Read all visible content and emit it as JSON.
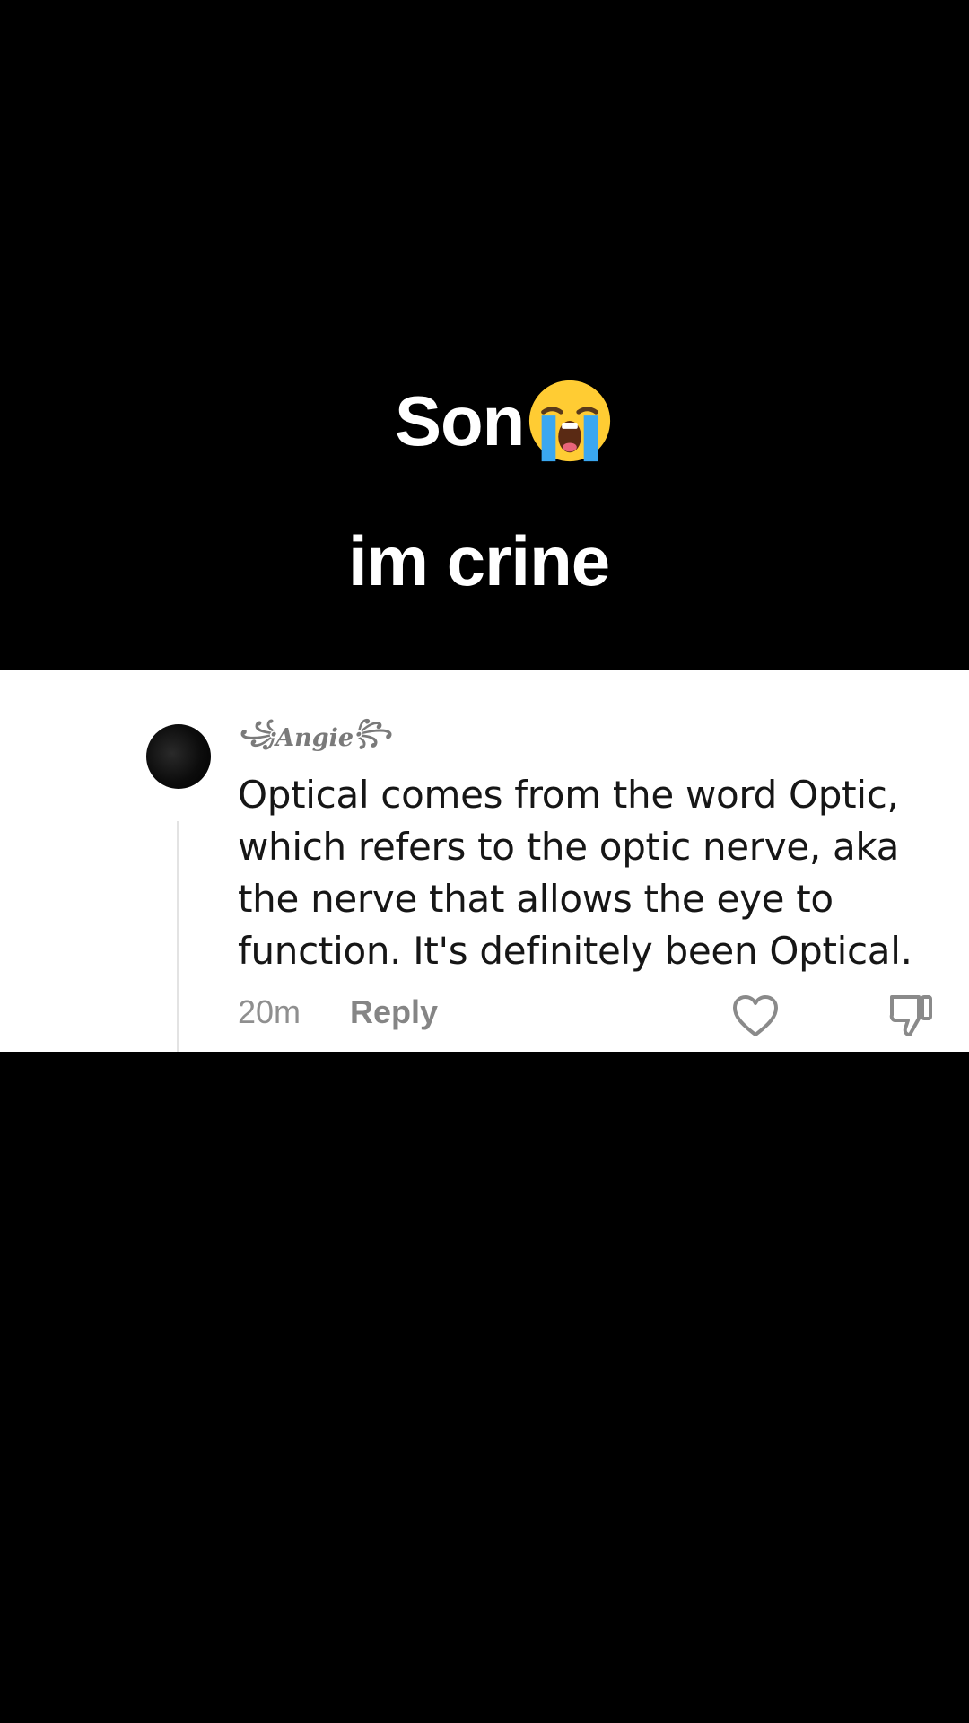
{
  "caption": {
    "line1": "Son",
    "line2": "im crine",
    "emoji": "loudly-crying-face"
  },
  "comment": {
    "username": "Angie",
    "text": "Optical comes from the word Optic, which refers to the optic nerve, aka the nerve that allows the eye to function. It's definitely been Optical.",
    "time": "20m",
    "reply_label": "Reply"
  },
  "icons": {
    "like": "heart-outline-icon",
    "dislike": "thumbs-down-outline-icon"
  },
  "colors": {
    "background": "#000000",
    "card": "#ffffff",
    "text": "#161616",
    "muted": "#8f8f8f"
  }
}
